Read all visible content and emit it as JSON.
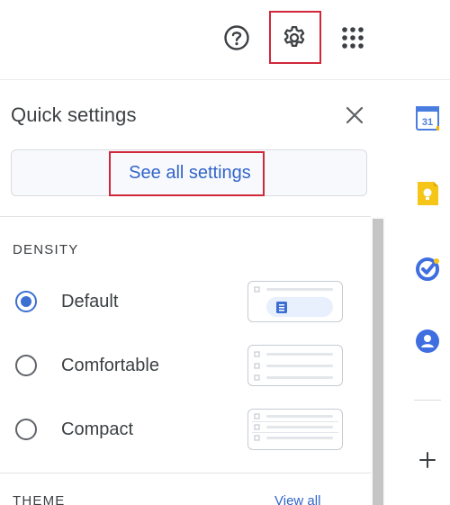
{
  "header": {
    "help_icon": "help-circle-icon",
    "settings_icon": "gear-icon",
    "apps_icon": "apps-grid-icon"
  },
  "quick_settings": {
    "title": "Quick settings",
    "close_icon": "close-icon",
    "see_all_label": "See all settings",
    "density": {
      "heading": "DENSITY",
      "options": [
        {
          "label": "Default",
          "selected": true
        },
        {
          "label": "Comfortable",
          "selected": false
        },
        {
          "label": "Compact",
          "selected": false
        }
      ]
    },
    "theme": {
      "heading": "THEME",
      "view_all": "View all"
    }
  },
  "side_panel": {
    "items": [
      {
        "name": "calendar-icon",
        "label": "31"
      },
      {
        "name": "keep-icon"
      },
      {
        "name": "tasks-icon"
      },
      {
        "name": "contacts-icon"
      }
    ],
    "add_icon": "plus-icon"
  },
  "colors": {
    "accent": "#3c6fd1",
    "highlight": "#d0283a",
    "calendar": "#4a7de0",
    "keep": "#f5c518",
    "tasks": "#3f6ee0",
    "contacts": "#3f6ee0"
  }
}
